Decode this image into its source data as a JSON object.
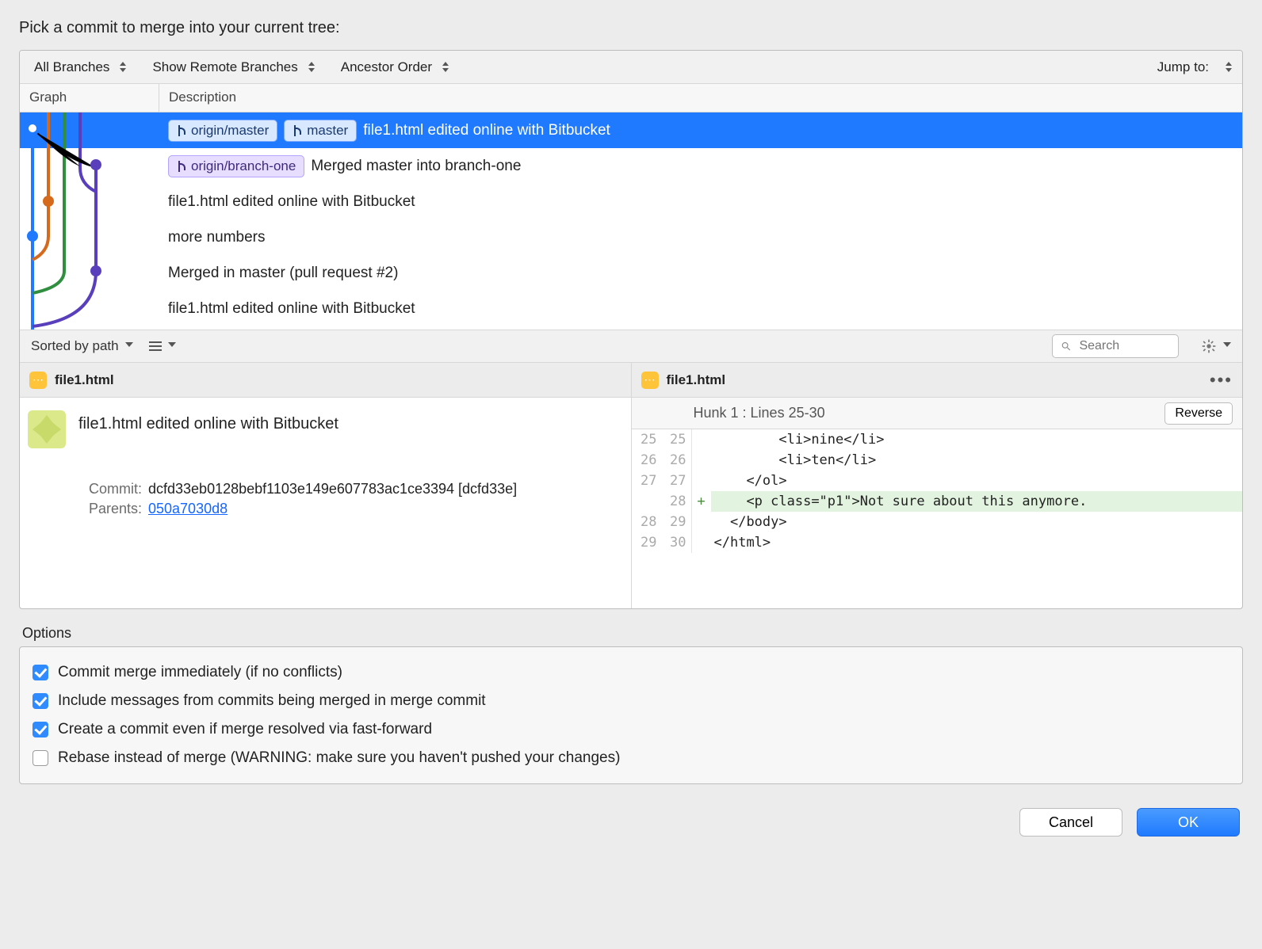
{
  "title": "Pick a commit to merge into your current tree:",
  "filters": {
    "branches": "All Branches",
    "remote": "Show Remote Branches",
    "order": "Ancestor Order",
    "jump": "Jump to:"
  },
  "columns": {
    "graph": "Graph",
    "desc": "Description"
  },
  "commits": [
    {
      "tags": [
        {
          "label": "origin/master",
          "style": "blue"
        },
        {
          "label": "master",
          "style": "blue"
        }
      ],
      "msg": "file1.html edited online with Bitbucket",
      "selected": true
    },
    {
      "tags": [
        {
          "label": "origin/branch-one",
          "style": "purple"
        }
      ],
      "msg": "Merged master into branch-one"
    },
    {
      "tags": [],
      "msg": "file1.html edited online with Bitbucket"
    },
    {
      "tags": [],
      "msg": "more numbers"
    },
    {
      "tags": [],
      "msg": "Merged in master (pull request #2)"
    },
    {
      "tags": [],
      "msg": "file1.html edited online with Bitbucket"
    }
  ],
  "midbar": {
    "sort": "Sorted by path",
    "search_ph": "Search"
  },
  "left_pane": {
    "file": "file1.html",
    "subject": "file1.html edited online with Bitbucket",
    "commit_label": "Commit:",
    "commit_hash": "dcfd33eb0128bebf1103e149e607783ac1ce3394 [dcfd33e]",
    "parents_label": "Parents:",
    "parent_hash": "050a7030d8"
  },
  "right_pane": {
    "file": "file1.html",
    "hunk": "Hunk 1 : Lines 25-30",
    "reverse": "Reverse",
    "lines": [
      {
        "a": "25",
        "b": "25",
        "op": " ",
        "txt": "        <li>nine</li>"
      },
      {
        "a": "26",
        "b": "26",
        "op": " ",
        "txt": "        <li>ten</li>"
      },
      {
        "a": "27",
        "b": "27",
        "op": " ",
        "txt": "    </ol>"
      },
      {
        "a": "",
        "b": "28",
        "op": "+",
        "txt": "    <p class=\"p1\">Not sure about this anymore."
      },
      {
        "a": "28",
        "b": "29",
        "op": " ",
        "txt": "  </body>"
      },
      {
        "a": "29",
        "b": "30",
        "op": " ",
        "txt": "</html>"
      }
    ]
  },
  "options_label": "Options",
  "options": [
    {
      "checked": true,
      "label": "Commit merge immediately (if no conflicts)"
    },
    {
      "checked": true,
      "label": "Include messages from commits being merged in merge commit"
    },
    {
      "checked": true,
      "label": "Create a commit even if merge resolved via fast-forward"
    },
    {
      "checked": false,
      "label": "Rebase instead of merge (WARNING: make sure you haven't pushed your changes)"
    }
  ],
  "buttons": {
    "cancel": "Cancel",
    "ok": "OK"
  }
}
